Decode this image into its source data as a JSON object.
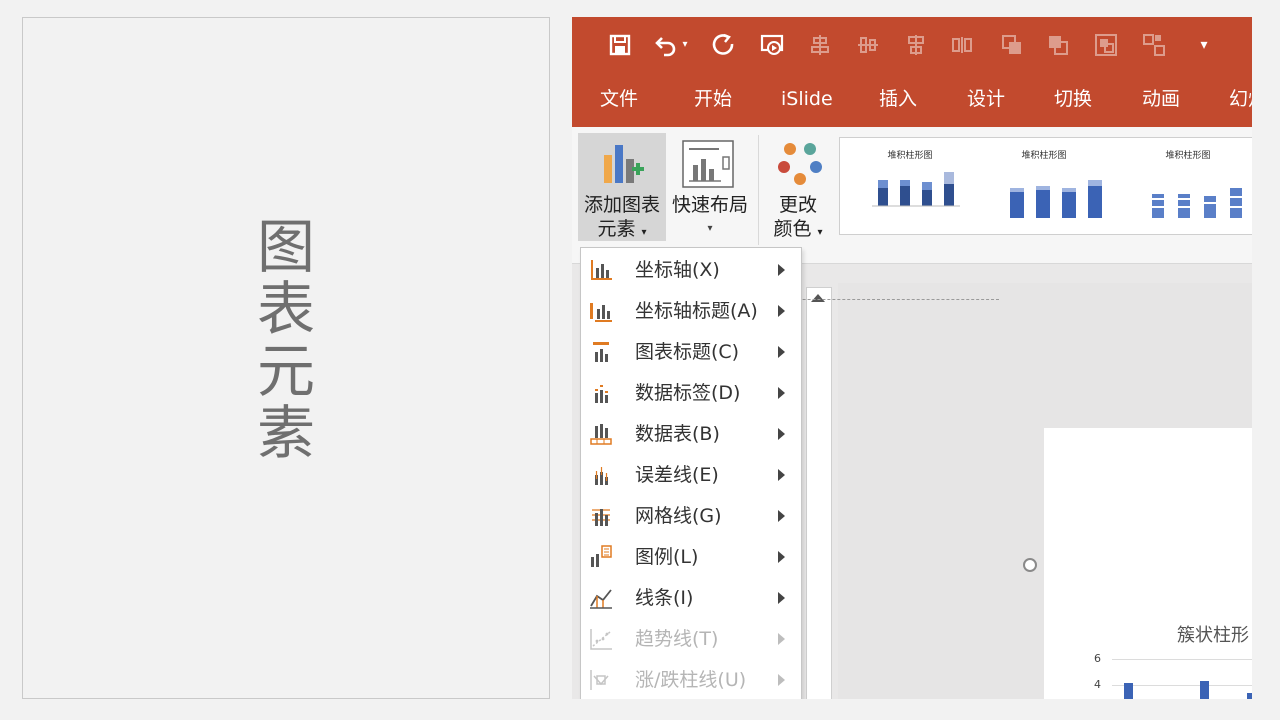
{
  "left_title": {
    "chars": [
      "图",
      "表",
      "元",
      "素"
    ]
  },
  "menubar": {
    "tabs": [
      "文件",
      "开始",
      "iSlide",
      "插入",
      "设计",
      "切换",
      "动画",
      "幻灯"
    ]
  },
  "ribbon": {
    "add_element": {
      "line1": "添加图表",
      "line2": "元素"
    },
    "quick_layout": {
      "line1": "快速布局"
    },
    "change_color": {
      "line1": "更改",
      "line2": "颜色"
    },
    "gallery": [
      {
        "title": "堆积柱形图"
      },
      {
        "title": "堆积柱形图"
      },
      {
        "title": "堆积柱形图"
      }
    ]
  },
  "dropdown": {
    "items": [
      {
        "label": "坐标轴(X)",
        "icon": "axes-icon",
        "disabled": false
      },
      {
        "label": "坐标轴标题(A)",
        "icon": "axis-title-icon",
        "disabled": false
      },
      {
        "label": "图表标题(C)",
        "icon": "chart-title-icon",
        "disabled": false
      },
      {
        "label": "数据标签(D)",
        "icon": "data-labels-icon",
        "disabled": false
      },
      {
        "label": "数据表(B)",
        "icon": "data-table-icon",
        "disabled": false
      },
      {
        "label": "误差线(E)",
        "icon": "error-bars-icon",
        "disabled": false
      },
      {
        "label": "网格线(G)",
        "icon": "gridlines-icon",
        "disabled": false
      },
      {
        "label": "图例(L)",
        "icon": "legend-icon",
        "disabled": false
      },
      {
        "label": "线条(I)",
        "icon": "lines-icon",
        "disabled": false
      },
      {
        "label": "趋势线(T)",
        "icon": "trendline-icon",
        "disabled": true
      },
      {
        "label": "涨/跌柱线(U)",
        "icon": "up-down-bars-icon",
        "disabled": true
      }
    ]
  },
  "slide_chart": {
    "title": "簇状柱形",
    "y_ticks": [
      "6",
      "4"
    ]
  }
}
